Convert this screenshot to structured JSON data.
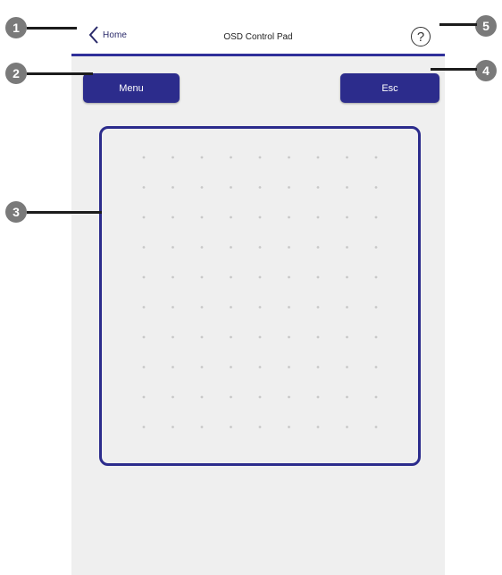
{
  "nav": {
    "back_label": "Home",
    "title": "OSD Control Pad",
    "help_symbol": "?"
  },
  "buttons": {
    "menu": "Menu",
    "esc": "Esc"
  },
  "callouts": [
    "1",
    "2",
    "3",
    "4",
    "5"
  ],
  "colors": {
    "accent": "#2c2c8c",
    "background": "#efefef",
    "callout": "#7a7a7a"
  },
  "icons": {
    "back": "chevron-left-icon",
    "help": "question-circle-icon"
  }
}
